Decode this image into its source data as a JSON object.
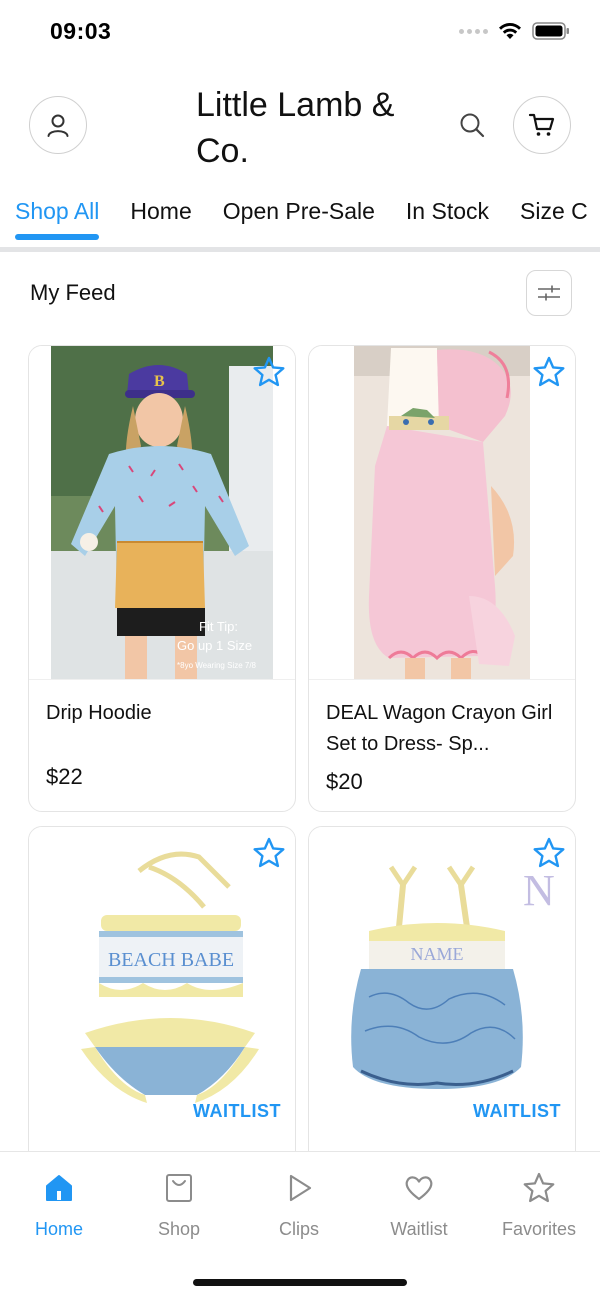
{
  "status": {
    "time": "09:03"
  },
  "header": {
    "title": "Little Lamb & Co."
  },
  "tabs": [
    {
      "label": "Shop All",
      "active": true
    },
    {
      "label": "Home",
      "active": false
    },
    {
      "label": "Open Pre-Sale",
      "active": false
    },
    {
      "label": "In Stock",
      "active": false
    },
    {
      "label": "Size C",
      "active": false
    }
  ],
  "feed": {
    "title": "My Feed"
  },
  "products": [
    {
      "name": "Drip Hoodie",
      "price": "$22",
      "image_caption": [
        "Fit Tip:",
        "Go up 1 Size",
        "*8yo Wearing Size 7/8"
      ],
      "badge": ""
    },
    {
      "name": "DEAL Wagon Crayon Girl Set to Dress- Sp...",
      "price": "$20",
      "badge": ""
    },
    {
      "name": "",
      "price": "",
      "image_text": "BEACH BABE",
      "badge": "WAITLIST"
    },
    {
      "name": "",
      "price": "",
      "image_text": "NAME",
      "image_letter": "N",
      "badge": "WAITLIST"
    }
  ],
  "bottom_nav": [
    {
      "label": "Home",
      "icon": "home-icon",
      "active": true
    },
    {
      "label": "Shop",
      "icon": "shopping-bag-icon",
      "active": false
    },
    {
      "label": "Clips",
      "icon": "play-icon",
      "active": false
    },
    {
      "label": "Waitlist",
      "icon": "heart-icon",
      "active": false
    },
    {
      "label": "Favorites",
      "icon": "star-icon",
      "active": false
    }
  ],
  "colors": {
    "accent": "#2196f3",
    "text": "#111111",
    "muted": "#8c8c8c",
    "border": "#e4e4e4"
  }
}
